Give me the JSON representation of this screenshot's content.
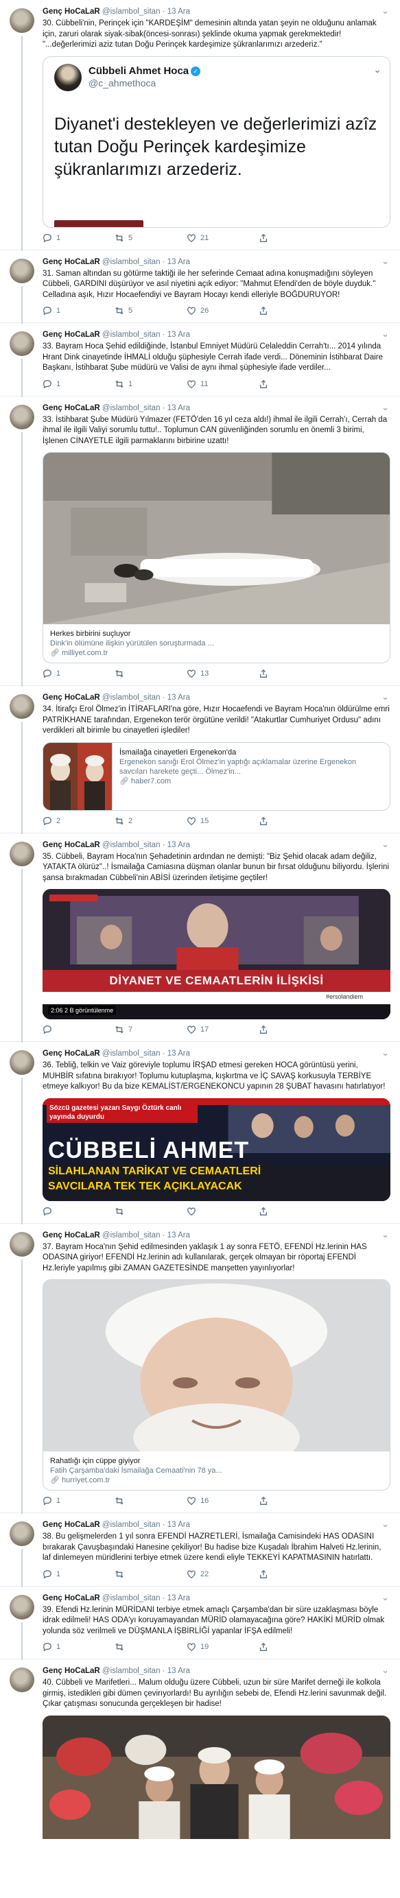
{
  "tweets": [
    {
      "name": "Genç HoCaLaR",
      "handle": "@islambol_sitan",
      "date": "13 Ara",
      "text": "30. Cübbeli'nin, Perinçek için \"KARDEŞİM\" demesinin altında yatan şeyin ne olduğunu anlamak için, zaruri olarak siyak-sibak(öncesi-sonrası) şeklinde okuma yapmak gerekmektedir! \"...değerlerimizi aziz tutan Doğu Perinçek kardeşimize şükranlarımızı arzederiz.\"",
      "replies": "1",
      "retweets": "5",
      "likes": "21",
      "quote": {
        "name": "Cübbeli Ahmet Hoca",
        "handle": "@c_ahmethoca",
        "text": "Diyanet'i destekleyen ve değerlerimizi azîz tutan Doğu Perinçek kardeşimize şükranlarımızı arzederiz."
      }
    },
    {
      "name": "Genç HoCaLaR",
      "handle": "@islambol_sitan",
      "date": "13 Ara",
      "text": "31. Saman altından su götürme taktiği ile her seferinde Cemaat adına konuşmadığını söyleyen Cübbeli, GARDINI düşürüyor ve asıl niyetini açık ediyor: \"Mahmut Efendi'den de böyle duyduk.\" Celladına aşık, Hızır Hocaefendiyi ve Bayram Hocayı kendi elleriyle BOĞDURUYOR!",
      "replies": "1",
      "retweets": "5",
      "likes": "26"
    },
    {
      "name": "Genç HoCaLaR",
      "handle": "@islambol_sitan",
      "date": "13 Ara",
      "text": "33. Bayram Hoca Şehid edildiğinde, İstanbul Emniyet Müdürü Celaleddin Cerrah'tı... 2014 yılında Hrant Dink cinayetinde İHMALİ olduğu şüphesiyle Cerrah ifade verdi... Döneminin İstihbarat Daire Başkanı, İstihbarat Şube müdürü ve Valisi de aynı ihmal şüphesiyle ifade verdiler...",
      "replies": "1",
      "retweets": "1",
      "likes": "11"
    },
    {
      "name": "Genç HoCaLaR",
      "handle": "@islambol_sitan",
      "date": "13 Ara",
      "text": "33. İstihbarat Şube Müdürü Yılmazer (FETÖ'den 16 yıl ceza aldı!) ihmal ile ilgili Cerrah'ı, Cerrah da ihmal ile ilgili Valiyi sorumlu tuttu!.. Toplumun CAN güvenliğinden sorumlu en önemli 3 birimi, İşlenen CİNAYETLE ilgili parmaklarını birbirine uzattı!",
      "replies": "1",
      "retweets": "",
      "likes": "13",
      "card": {
        "title": "Herkes birbirini suçluyor",
        "desc": "Dink'in ölümüne ilişkin yürütülen soruşturmada ...",
        "domain": "milliyet.com.tr"
      }
    },
    {
      "name": "Genç HoCaLaR",
      "handle": "@islambol_sitan",
      "date": "13 Ara",
      "text": "34. İtirafçı Erol Ölmez'in İTİRAFLARI'na göre, Hızır Hocaefendi ve Bayram Hoca'nın öldürülme emri PATRİKHANE tarafından, Ergenekon terör örgütüne verildi! \"Atakurtlar Cumhuriyet Ordusu\" adını verdikleri alt birimle bu cinayetleri işlediler!",
      "replies": "2",
      "retweets": "2",
      "likes": "15",
      "card": {
        "title": "İsmailağa cinayetleri Ergenekon'da",
        "desc": "Ergenekon sanığı Erol Ölmez'in yaptığı açıklamalar üzerine Ergenekon savcıları harekete geçti... Ölmez'in...",
        "domain": "haber7.com"
      }
    },
    {
      "name": "Genç HoCaLaR",
      "handle": "@islambol_sitan",
      "date": "13 Ara",
      "text": "35. Cübbeli, Bayram Hoca'nın Şehadetinin ardından ne demişti: \"Biz Şehid olacak adam değiliz, YATAKTA ölürüz\"..! İsmailağa Camiasına düşman olanlar bunun bir fırsat olduğunu biliyordu. İşlerini şansa bırakmadan Cübbeli'nin ABİSİ üzerinden iletişime geçtiler!",
      "replies": "",
      "retweets": "7",
      "likes": "17",
      "video": {
        "time": "2:06",
        "views": "2 B görüntülenme",
        "headline": "DİYANET VE CEMAATLERİN İLİŞKİSİ",
        "ticker": "#ersolandiem"
      }
    },
    {
      "name": "Genç HoCaLaR",
      "handle": "@islambol_sitan",
      "date": "13 Ara",
      "text": "36. Tebliğ, telkin ve Vaiz göreviyle toplumu İRŞAD etmesi gereken HOCA görüntüsü yerini, MUHBİR sıfatına bırakıyor! Toplumu kutuplaşma, kışkırtma ve İÇ SAVAŞ korkusuyla TERBİYE etmeye kalkıyor! Bu da bize KEMALİST/ERGENEKONCU yapının 28 ŞUBAT havasını hatırlatıyor!",
      "replies": "",
      "retweets": "",
      "likes": "",
      "banner": {
        "label": "Sözcü gazetesi yazarı Saygı Öztürk canlı yayında duyurdu",
        "big": "CÜBBELİ AHMET",
        "sub1": "SİLAHLANAN TARİKAT VE CEMAATLERİ",
        "sub2": "SAVCILARA TEK TEK AÇIKLAYACAK"
      }
    },
    {
      "name": "Genç HoCaLaR",
      "handle": "@islambol_sitan",
      "date": "13 Ara",
      "text": "37. Bayram Hoca'nın Şehid edilmesinden yaklaşık 1 ay sonra FETÖ, EFENDİ Hz.lerinin HAS ODASINA giriyor! EFENDİ Hz.lerinin adı kullanılarak, gerçek olmayan bir röportaj EFENDİ Hz.leriyle yapılmış gibi ZAMAN GAZETESİNDE manşetten yayınlıyorlar!",
      "replies": "1",
      "retweets": "",
      "likes": "16",
      "card": {
        "title": "Rahatlığı için cüppe giyiyor",
        "desc": "Fatih Çarşamba'daki İsmailağa Cemaati'nin 78 ya...",
        "domain": "hurriyet.com.tr"
      }
    },
    {
      "name": "Genç HoCaLaR",
      "handle": "@islambol_sitan",
      "date": "13 Ara",
      "text": "38. Bu gelişmelerden 1 yıl sonra EFENDİ HAZRETLERİ, İsmailağa Camisindeki HAS ODASINI bırakarak Çavuşbaşındaki Hanesine çekiliyor! Bu hadise bize Kuşadalı İbrahim Halveti Hz.lerinin, laf dinlemeyen müridlerini terbiye etmek üzere kendi eliyle TEKKEYİ KAPATMASININ hatırlattı.",
      "replies": "1",
      "retweets": "",
      "likes": "22"
    },
    {
      "name": "Genç HoCaLaR",
      "handle": "@islambol_sitan",
      "date": "13 Ara",
      "text": "39. Efendi Hz.lerinin MÜRİDANI terbiye etmek amaçlı Çarşamba'dan bir süre uzaklaşması böyle idrak edilmeli! HAS ODA'yı koruyamayandan MÜRİD olamayacağına göre? HAKİKİ MÜRİD olmak yolunda söz verilmeli ve DÜŞMANLA İŞBİRLİĞİ yapanlar İFŞA edilmeli!",
      "replies": "1",
      "retweets": "",
      "likes": "19"
    },
    {
      "name": "Genç HoCaLaR",
      "handle": "@islambol_sitan",
      "date": "13 Ara",
      "text": "40. Cübbeli ve Marifetleri... Malum olduğu üzere Cübbeli, uzun bir süre Marifet derneği ile kolkola girmiş, istedikleri gibi dümen çevirıyorlardı! Bu ayrılığın sebebi de, Efendi Hz.lerini savunmak değil. Çıkar çatışması sonucunda gerçekleşen bir hadise!"
    }
  ]
}
